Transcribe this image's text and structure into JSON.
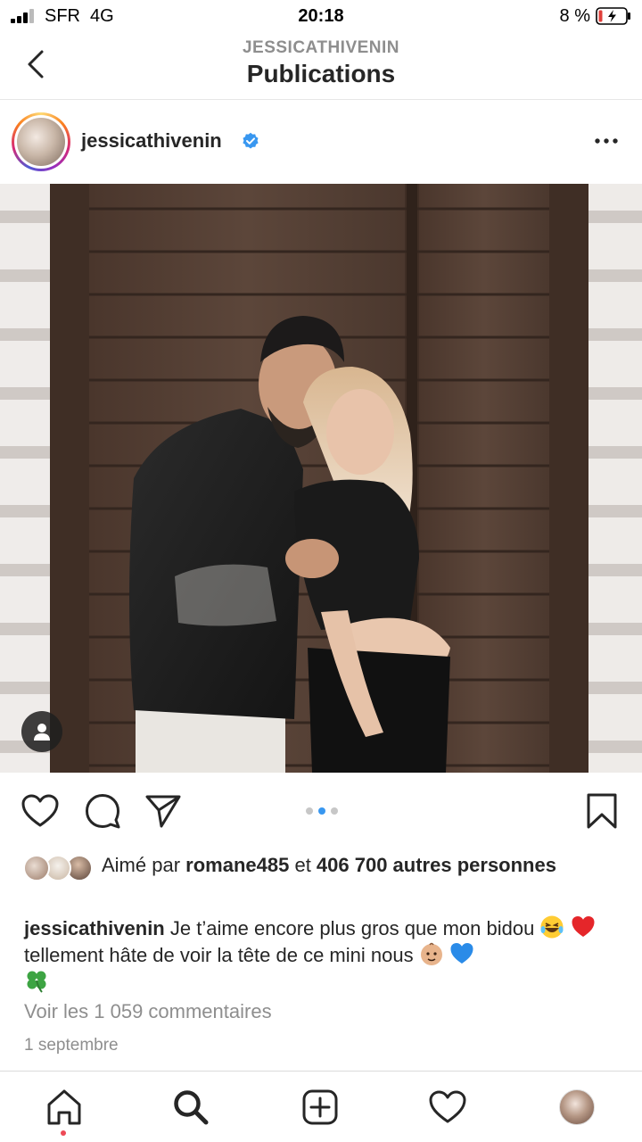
{
  "status_bar": {
    "carrier": "SFR",
    "network": "4G",
    "time": "20:18",
    "battery_percent": "8 %",
    "battery_color": "#e0403b"
  },
  "header": {
    "subtitle": "JESSICATHIVENIN",
    "title": "Publications",
    "back_icon": "chevron-left-icon"
  },
  "post": {
    "username": "jessicathivenin",
    "verified": true,
    "verified_color": "#3897f0",
    "more_icon": "more-horizontal-icon",
    "tag_icon": "user-tag-icon",
    "carousel": {
      "count": 3,
      "active_index": 1
    },
    "actions": {
      "like_icon": "heart-icon",
      "comment_icon": "comment-icon",
      "share_icon": "send-icon",
      "save_icon": "bookmark-icon"
    },
    "likes": {
      "prefix": "Aimé par ",
      "liker": "romane485",
      "middle": " et ",
      "others": "406 700 autres personnes"
    },
    "caption": {
      "username": "jessicathivenin",
      "text_1": " Je t’aime encore plus gros que mon bidou ",
      "text_2": " tellement hâte de voir la tête de ce mini nous "
    },
    "view_comments": "Voir les 1 059 commentaires",
    "date": "1 septembre"
  },
  "bottom_nav": {
    "items": [
      {
        "name": "home",
        "icon": "home-icon"
      },
      {
        "name": "search",
        "icon": "search-icon"
      },
      {
        "name": "create",
        "icon": "plus-square-icon"
      },
      {
        "name": "activity",
        "icon": "heart-icon"
      },
      {
        "name": "profile",
        "icon": "profile-avatar"
      }
    ],
    "notification_color": "#ed4956"
  }
}
